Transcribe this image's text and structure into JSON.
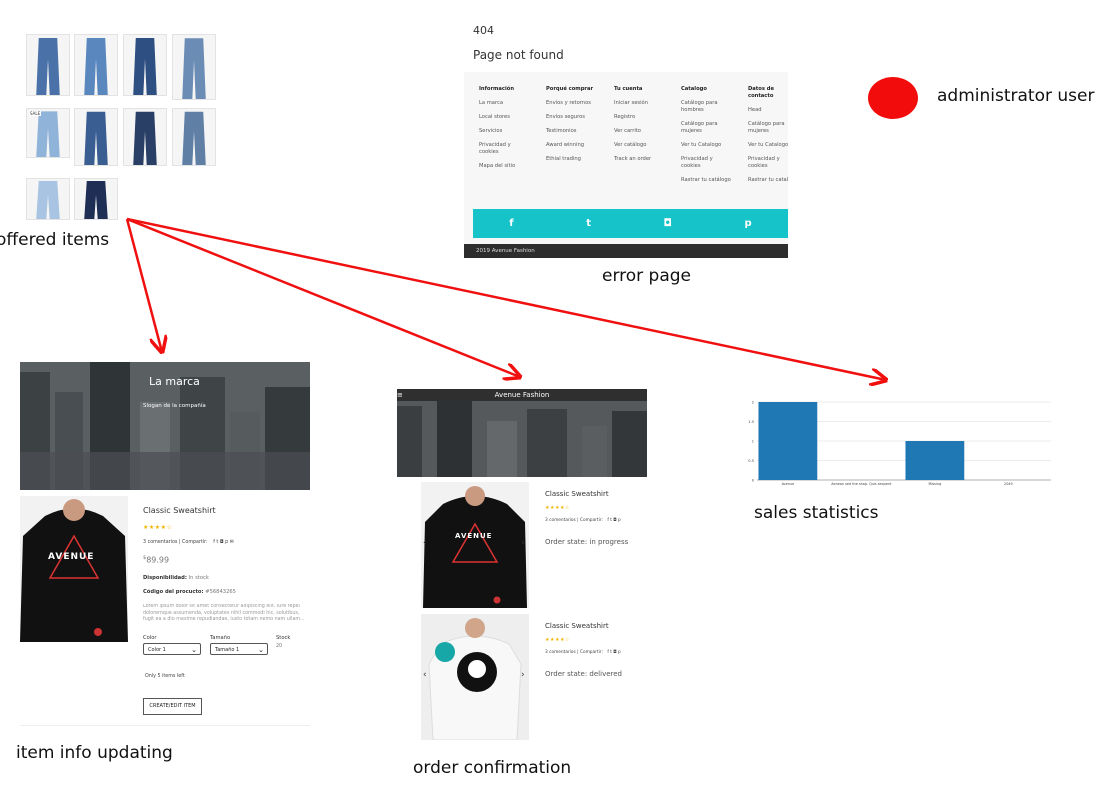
{
  "captions": {
    "offered_items": "offered items",
    "error_page": "error page",
    "administrator_user": "administrator user",
    "item_info_updating": "item info updating",
    "order_confirmation": "order confirmation",
    "sales_statistics": "sales statistics"
  },
  "offered_items": {
    "thumbnails": [
      {
        "tone": "#4a72a8"
      },
      {
        "tone": "#5b87bf"
      },
      {
        "tone": "#2e4f82"
      },
      {
        "tone": "#6b8db5"
      },
      {
        "tone": "#8fb3d9",
        "tag": "SALE"
      },
      {
        "tone": "#3a5e92"
      },
      {
        "tone": "#2a3f66"
      },
      {
        "tone": "#5f7fa5"
      },
      {
        "tone": "#a8c4e2"
      },
      {
        "tone": "#1f2e55"
      }
    ]
  },
  "error_page": {
    "code": "404",
    "title": "Page not found",
    "footer_columns": [
      {
        "heading": "Información",
        "items": [
          "La marca",
          "Local stores",
          "Servicios",
          "Privacidad y cookies",
          "Mapa del sitio"
        ]
      },
      {
        "heading": "Porqué comprar",
        "items": [
          "Envíos y retornos",
          "Envíos seguros",
          "Testimonios",
          "Award winning",
          "Ethial trading"
        ]
      },
      {
        "heading": "Tu cuenta",
        "items": [
          "Iniciar sesión",
          "Registro",
          "Ver carrito",
          "Ver catálogo",
          "Track an order"
        ]
      },
      {
        "heading": "Catalogo",
        "items": [
          "Catálogo para hombres",
          "Catálogo para mujeres",
          "Ver tu Catalogo",
          "Privacidad y cookies",
          "Rastrar tu catálogo"
        ]
      },
      {
        "heading": "Datos de contacto",
        "items": [
          "Head",
          "Catálogo para mujeres",
          "Ver tu Catalogo",
          "Privacidad y cookies",
          "Rastrar tu catalo"
        ]
      }
    ],
    "social_icons": [
      "f",
      "t",
      "◘",
      "p"
    ],
    "copyright": "2019 Avenue Fashion"
  },
  "item_info": {
    "brand": "La marca",
    "slogan": "Slogan de la compañía",
    "product_title": "Classic Sweatshirt",
    "stars": "★★★★☆",
    "comments": "3 comentarios | Compartir:",
    "share_icons": "f  t  ◘  p  ✉",
    "price_symbol": "$",
    "price": "89.99",
    "availability_label": "Disponibilidad:",
    "availability_value": "In stock",
    "code_label": "Código del procucto:",
    "code_value": "#56843265",
    "description": "Lorem ipsum dolor sit amet consectetur adipiscing elit. Iure repel doloremque assumenda, voluptates nihil commodi hic, solutibus, fugit ea a dio maxime repudiandae, iusto totam nemo nam ullam...",
    "color_label": "Color",
    "color_value": "Color 1",
    "size_label": "Tamaño",
    "size_value": "Tamaño 1",
    "stock_label": "Stock",
    "stock_value": "20",
    "only_left": "Only 5 items left",
    "button": "CREATE/EDIT ITEM",
    "shirt_text": "AVENUE"
  },
  "order_confirmation": {
    "header": "Avenue Fashion",
    "menu_icon": "≡",
    "orders": [
      {
        "title": "Classic Sweatshirt",
        "stars": "★★★★☆",
        "comments": "3 comentarios | Compartir:",
        "share": "f  t  ◘  p",
        "state": "Order state: in progress",
        "shirt": "black",
        "shirt_text": "AVENUE"
      },
      {
        "title": "Classic Sweatshirt",
        "stars": "★★★★☆",
        "comments": "3 comentarios | Compartir:",
        "share": "f  t  ◘  p",
        "state": "Order state: delivered",
        "shirt": "white",
        "shirt_text": ""
      }
    ]
  },
  "chart_data": {
    "type": "bar",
    "categories": [
      "Avenue",
      "Aenean sed the shop. Quis sequent",
      "Missing",
      "2049"
    ],
    "values": [
      2,
      0,
      1,
      0
    ],
    "yticks": [
      0,
      0.5,
      1,
      1.5,
      2
    ],
    "ytick_labels": [
      "0",
      "0.5",
      "1",
      "1.5",
      "2"
    ],
    "ylim": [
      0,
      2
    ],
    "grid": true,
    "bar_color": "#1f77b4",
    "title": "",
    "xlabel": "",
    "ylabel": ""
  }
}
